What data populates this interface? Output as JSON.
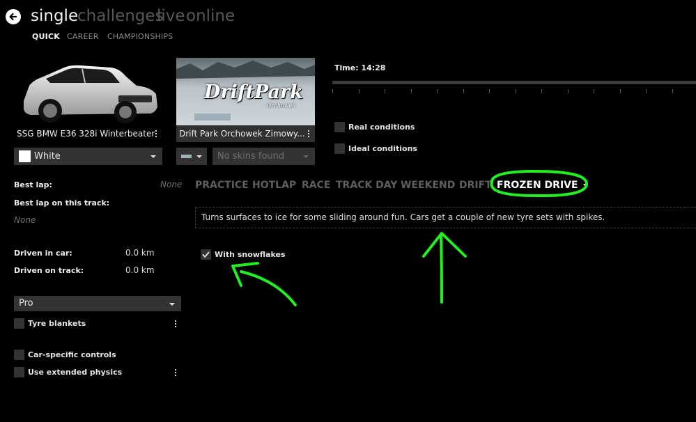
{
  "nav": {
    "main_tabs": [
      {
        "label": "single",
        "active": true
      },
      {
        "label": "challenges",
        "active": false
      },
      {
        "label": "live",
        "active": false
      },
      {
        "label": "online",
        "active": false
      }
    ],
    "sub_tabs": [
      {
        "label": "QUICK",
        "active": true
      },
      {
        "label": "CAREER",
        "active": false
      },
      {
        "label": "CHAMPIONSHIPS",
        "active": false
      }
    ]
  },
  "car": {
    "name": "SSG BMW E36 328i Winterbeater",
    "skin": "White",
    "skin_color": "#ffffff"
  },
  "track": {
    "name": "Drift Park Orchowek Zimowy...",
    "logo_text": "DriftPark",
    "logo_subtext": "Orchowek",
    "skin": "No skins found"
  },
  "conditions": {
    "time_label": "Time: 14:28",
    "time_position": 0.52,
    "real_conditions": "Real conditions",
    "ideal_conditions": "Ideal conditions"
  },
  "stats": {
    "best_lap_label": "Best lap:",
    "best_lap_value": "None",
    "best_lap_track_label": "Best lap on this track:",
    "best_lap_track_value": "None",
    "driven_car_label": "Driven in car:",
    "driven_car_value": "0.0 km",
    "driven_track_label": "Driven on track:",
    "driven_track_value": "0.0 km"
  },
  "assists": {
    "preset": "Pro",
    "tyre_blankets": "Tyre blankets",
    "car_specific_controls": "Car-specific controls",
    "extended_physics": "Use extended physics"
  },
  "modes": {
    "tabs": [
      "PRACTICE",
      "HOTLAP",
      "RACE",
      "TRACK DAY",
      "WEEKEND",
      "DRIFT"
    ],
    "active": "FROZEN DRIVE",
    "description": "Turns surfaces to ice for some sliding around fun. Cars get a couple of new tyre sets with spikes.",
    "option_snowflakes": "With snowflakes",
    "option_snowflakes_checked": true
  },
  "colors": {
    "background": "#000000",
    "annotation": "#22ee22",
    "inactive_text": "#5e5e5e"
  }
}
